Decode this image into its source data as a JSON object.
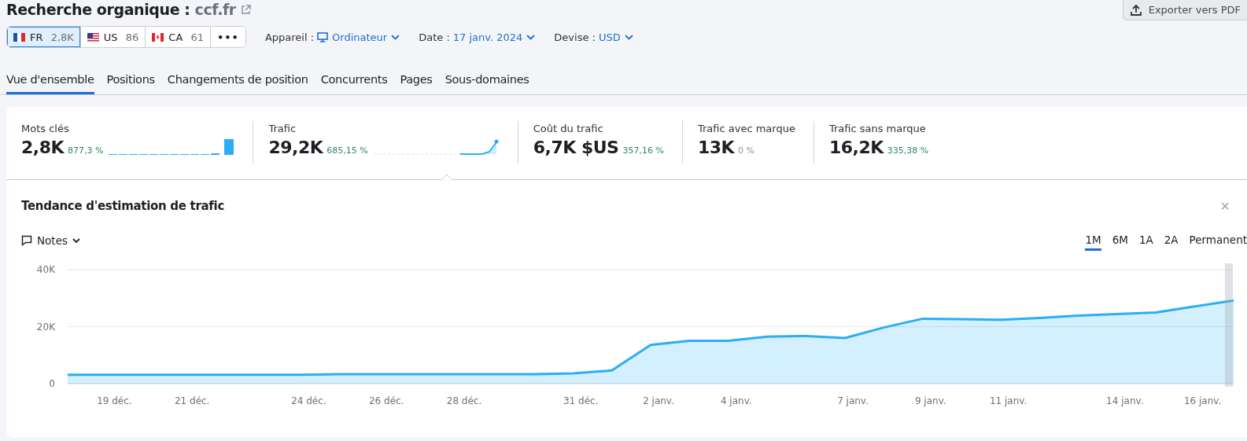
{
  "header": {
    "title": "Recherche organique :",
    "domain": "ccf.fr",
    "export_button": "Exporter vers PDF"
  },
  "databases": [
    {
      "code": "FR",
      "count": "2,8K",
      "selected": true
    },
    {
      "code": "US",
      "count": "86",
      "selected": false
    },
    {
      "code": "CA",
      "count": "61",
      "selected": false
    }
  ],
  "more_button": "•••",
  "filters": [
    {
      "label": "Appareil :",
      "value": "Ordinateur",
      "kind": "device"
    },
    {
      "label": "Date :",
      "value": "17 janv. 2024",
      "kind": "plain"
    },
    {
      "label": "Devise :",
      "value": "USD",
      "kind": "plain"
    }
  ],
  "tabs": [
    {
      "label": "Vue d'ensemble",
      "selected": true
    },
    {
      "label": "Positions",
      "selected": false
    },
    {
      "label": "Changements de position",
      "selected": false
    },
    {
      "label": "Concurrents",
      "selected": false
    },
    {
      "label": "Pages",
      "selected": false
    },
    {
      "label": "Sous-domaines",
      "selected": false
    }
  ],
  "kpis": [
    {
      "label": "Mots clés",
      "value": "2,8K",
      "change": "877,3 %",
      "color": "#2e8a5d",
      "kind": "bars",
      "selected": false
    },
    {
      "label": "Trafic",
      "value": "29,2K",
      "change": "685,15 %",
      "color": "#2e8a5d",
      "kind": "line",
      "selected": true
    },
    {
      "label": "Coût du trafic",
      "value": "6,7K $US",
      "change": "357,16 %",
      "color": "#2e8a5d",
      "kind": "plain",
      "selected": false
    },
    {
      "label": "Trafic avec marque",
      "value": "13K",
      "change": "0 %",
      "color": "#8b8f9a",
      "kind": "plain",
      "selected": false
    },
    {
      "label": "Trafic sans marque",
      "value": "16,2K",
      "change": "335,38 %",
      "color": "#2e8a5d",
      "kind": "plain",
      "selected": false
    }
  ],
  "trend_panel": {
    "title": "Tendance d'estimation de trafic",
    "close": "×",
    "notes": "Notes",
    "ranges": [
      {
        "label": "1M",
        "selected": true
      },
      {
        "label": "6M",
        "selected": false
      },
      {
        "label": "1A",
        "selected": false
      },
      {
        "label": "2A",
        "selected": false
      },
      {
        "label": "Permanent",
        "selected": false
      }
    ],
    "chart_data": {
      "type": "area",
      "categories": [
        null,
        "19 déc.",
        null,
        "21 déc.",
        null,
        null,
        "24 déc.",
        null,
        "26 déc.",
        null,
        "28 déc.",
        null,
        null,
        "31 déc.",
        null,
        "2 janv.",
        null,
        "4 janv.",
        null,
        null,
        "7 janv.",
        null,
        "9 janv.",
        null,
        "11 janv.",
        null,
        null,
        "14 janv.",
        null,
        "16 janv.",
        null
      ],
      "series": [
        {
          "color": "#2aaef5",
          "values": [
            3100,
            3100,
            3100,
            3100,
            3100,
            3100,
            3100,
            3300,
            3300,
            3300,
            3300,
            3300,
            3300,
            3600,
            4600,
            13600,
            15000,
            15000,
            16500,
            16700,
            16000,
            19700,
            22800,
            22600,
            22400,
            23000,
            23900,
            24400,
            25000,
            27100,
            29200
          ]
        }
      ],
      "ylim": [
        0,
        40000
      ],
      "yticks": [
        {
          "value": 0,
          "label": "0"
        },
        {
          "value": 20000,
          "label": "20K"
        },
        {
          "value": 40000,
          "label": "40K"
        }
      ]
    }
  }
}
